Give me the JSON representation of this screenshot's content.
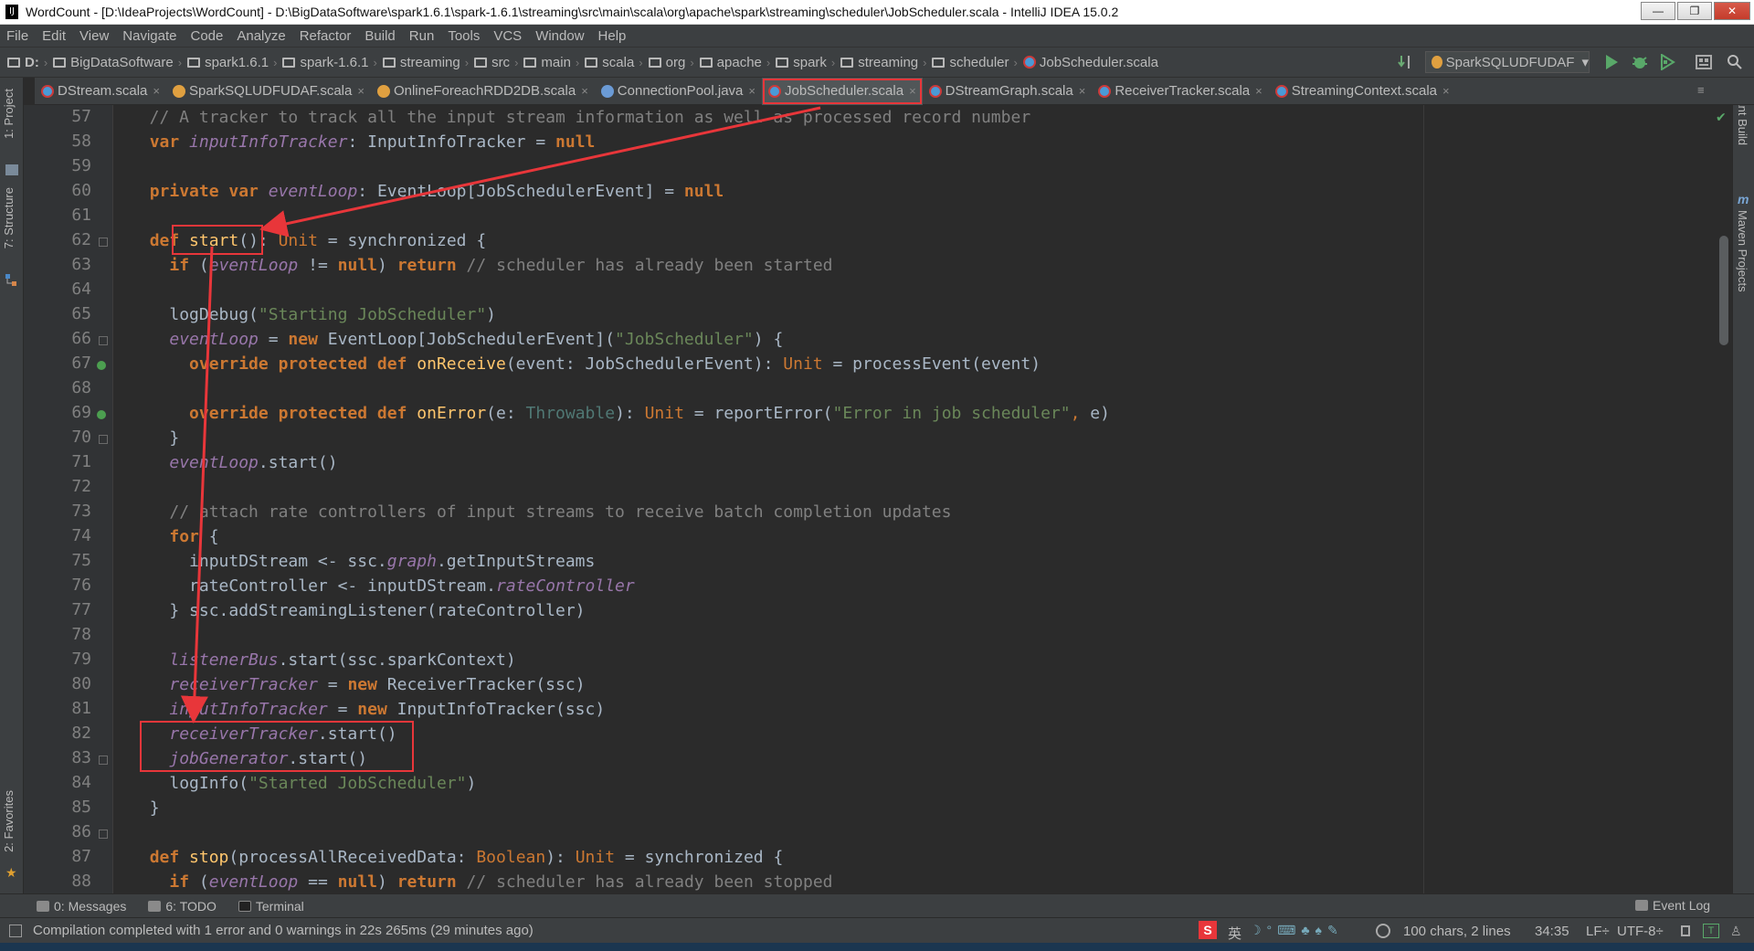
{
  "window": {
    "title": "WordCount - [D:\\IdeaProjects\\WordCount] - D:\\BigDataSoftware\\spark1.6.1\\spark-1.6.1\\streaming\\src\\main\\scala\\org\\apache\\spark\\streaming\\scheduler\\JobScheduler.scala - IntelliJ IDEA 15.0.2",
    "app_icon": "IJ",
    "minimize": "—",
    "maximize": "❐",
    "close": "✕"
  },
  "menu": [
    "File",
    "Edit",
    "View",
    "Navigate",
    "Code",
    "Analyze",
    "Refactor",
    "Build",
    "Run",
    "Tools",
    "VCS",
    "Window",
    "Help"
  ],
  "breadcrumb": [
    "D:",
    "BigDataSoftware",
    "spark1.6.1",
    "spark-1.6.1",
    "streaming",
    "src",
    "main",
    "scala",
    "org",
    "apache",
    "spark",
    "streaming",
    "scheduler",
    "JobScheduler.scala"
  ],
  "run_config": "SparkSQLUDFUDAF",
  "tabs": [
    {
      "label": "DStream.scala",
      "icon": "scala-icon"
    },
    {
      "label": "SparkSQLUDFUDAF.scala",
      "icon": "scala-object-icon"
    },
    {
      "label": "OnlineForeachRDD2DB.scala",
      "icon": "scala-object-icon"
    },
    {
      "label": "ConnectionPool.java",
      "icon": "java-icon"
    },
    {
      "label": "JobScheduler.scala",
      "icon": "scala-icon",
      "active": true
    },
    {
      "label": "DStreamGraph.scala",
      "icon": "scala-icon"
    },
    {
      "label": "ReceiverTracker.scala",
      "icon": "scala-icon"
    },
    {
      "label": "StreamingContext.scala",
      "icon": "scala-icon"
    }
  ],
  "left_tool_windows": [
    "1: Project",
    "7: Structure",
    "2: Favorites"
  ],
  "right_tool_windows": [
    "Ant Build",
    "Maven Projects"
  ],
  "code": {
    "line_numbers": [
      "57",
      "58",
      "59",
      "60",
      "61",
      "62",
      "63",
      "64",
      "65",
      "66",
      "67",
      "68",
      "69",
      "70",
      "71",
      "72",
      "73",
      "74",
      "75",
      "76",
      "77",
      "78",
      "79",
      "80",
      "81",
      "82",
      "83",
      "84",
      "85",
      "86",
      "87",
      "88"
    ],
    "l57": "  // A tracker to track all the input stream information as well as processed record number",
    "l58_kw": "var",
    "l58_name": "inputInfoTracker",
    "l58_rest": ": InputInfoTracker = ",
    "l58_null": "null",
    "l60_kw": "private var",
    "l60_name": "eventLoop",
    "l60_rest": ": EventLoop[JobSchedulerEvent] = ",
    "l60_null": "null",
    "l62_def": "def",
    "l62_fn": "start",
    "l62_paren": "(): ",
    "l62_unit": "Unit",
    "l62_rest": " = synchronized {",
    "l63_if": "if",
    "l63_open": " (",
    "l63_var": "eventLoop",
    "l63_ne": " != ",
    "l63_null": "null",
    "l63_close": ") ",
    "l63_return": "return",
    "l63_cm": " // scheduler has already been started",
    "l65_fn": "logDebug(",
    "l65_str": "\"Starting JobScheduler\"",
    "l65_close": ")",
    "l66_var": "eventLoop",
    "l66_eq": " = ",
    "l66_new": "new",
    "l66_type": " EventLoop[JobSchedulerEvent](",
    "l66_str": "\"JobScheduler\"",
    "l66_close": ") {",
    "l67_kw": "override protected def",
    "l67_fn": "onReceive",
    "l67_mid": "(event: JobSchedulerEvent): ",
    "l67_unit": "Unit",
    "l67_rest": " = processEvent(event)",
    "l69_kw": "override protected def",
    "l69_fn": "onError",
    "l69_e": "(e: ",
    "l69_thr": "Throwable",
    "l69_mid": "): ",
    "l69_unit": "Unit",
    "l69_mid2": " = reportError(",
    "l69_str": "\"Error in job scheduler\"",
    "l69_comma": ",",
    "l69_rest": " e)",
    "l70": "}",
    "l71_var": "eventLoop",
    "l71_rest": ".start()",
    "l73": "// attach rate controllers of input streams to receive batch completion updates",
    "l74_for": "for",
    "l74_rest": " {",
    "l75_a": "inputDStream <- ssc.",
    "l75_b": "graph",
    "l75_c": ".getInputStreams",
    "l76_a": "rateController <- inputDStream.",
    "l76_b": "rateController",
    "l77": "} ssc.addStreamingListener(rateController)",
    "l79_var": "listenerBus",
    "l79_rest": ".start(ssc.sparkContext)",
    "l80_var": "receiverTracker",
    "l80_eq": " = ",
    "l80_new": "new",
    "l80_rest": " ReceiverTracker(ssc)",
    "l81_var": "inputInfoTracker",
    "l81_eq": " = ",
    "l81_new": "new",
    "l81_rest": " InputInfoTracker(ssc)",
    "l82_var": "receiverTracker",
    "l82_rest": ".start()",
    "l83_var": "jobGenerator",
    "l83_rest": ".start()",
    "l84_fn": "logInfo(",
    "l84_str": "\"Started JobScheduler\"",
    "l84_close": ")",
    "l85": "}",
    "l87_def": "def",
    "l87_fn": "stop",
    "l87_mid": "(processAllReceivedData: ",
    "l87_bool": "Boolean",
    "l87_mid2": "): ",
    "l87_unit": "Unit",
    "l87_rest": " = synchronized {",
    "l88_if": "if",
    "l88_open": " (",
    "l88_var": "eventLoop",
    "l88_eq": " == ",
    "l88_null": "null",
    "l88_close": ") ",
    "l88_return": "return",
    "l88_cm": " // scheduler has already been stopped"
  },
  "bottom_tabs": [
    {
      "label": "0: Messages",
      "icon": "messages-icon"
    },
    {
      "label": "6: TODO",
      "icon": "todo-icon"
    },
    {
      "label": "Terminal",
      "icon": "terminal-icon"
    }
  ],
  "event_log": "Event Log",
  "status": {
    "message": "Compilation completed with 1 error and 0 warnings in 22s 265ms (29 minutes ago)",
    "selection": "100 chars, 2 lines",
    "caret": "34:35",
    "line_sep": "LF÷",
    "encoding": "UTF-8÷",
    "ime": "英"
  },
  "annotation_color": "#e8363a"
}
